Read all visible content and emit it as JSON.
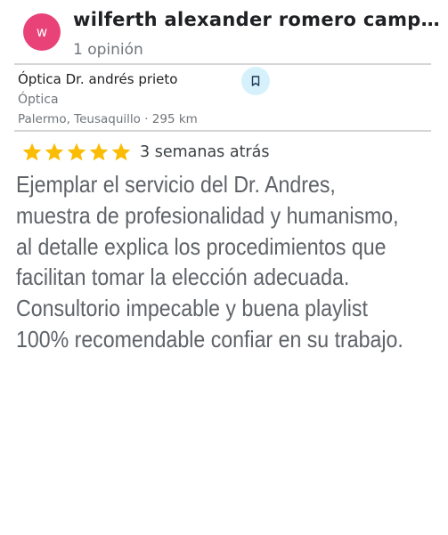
{
  "reviewer": {
    "avatar_letter": "w",
    "avatar_color": "#e94279",
    "name": "wilferth alexander romero campuz…",
    "review_count": "1 opinión"
  },
  "place": {
    "name": "Óptica Dr. andrés prieto",
    "category": "Óptica",
    "location": "Palermo, Teusaquillo · 295 km",
    "save_icon": "bookmark-icon",
    "save_button_color": "#d6f1fb"
  },
  "review": {
    "rating": 5,
    "max_rating": 5,
    "star_color": "#fbbc04",
    "date": "3 semanas atrás",
    "text_lines": [
      "Ejemplar el servicio del Dr. Andres,",
      "muestra de profesionalidad y humanismo,",
      "al detalle explica los procedimientos que",
      "facilitan tomar la elección adecuada.",
      "Consultorio impecable y buena playlist",
      "100% recomendable confiar en su trabajo."
    ]
  }
}
